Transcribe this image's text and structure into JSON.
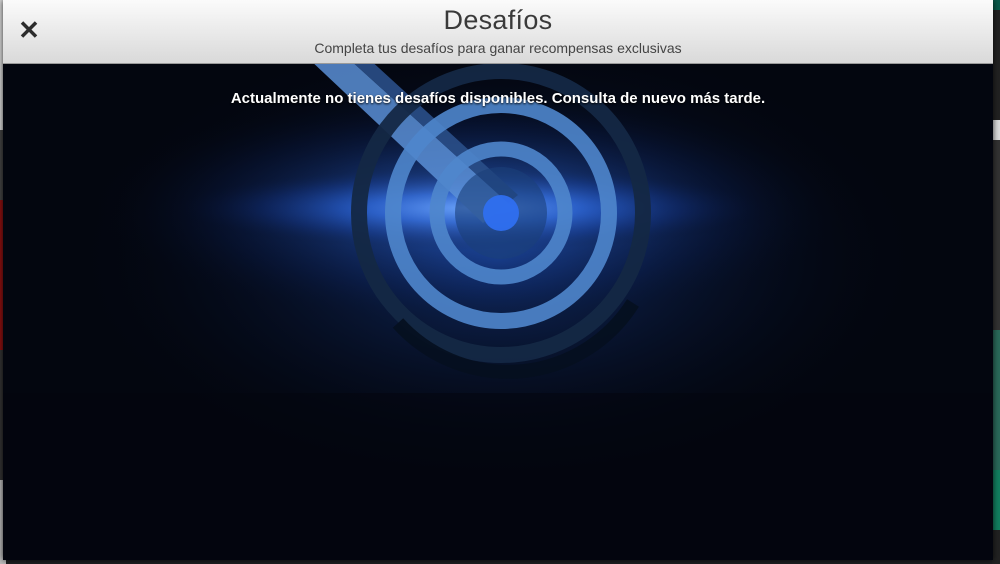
{
  "modal": {
    "title": "Desafíos",
    "subtitle": "Completa tus desafíos para ganar recompensas exclusivas",
    "message": "Actualmente no tienes desafíos disponibles. Consulta de nuevo más tarde.",
    "close_icon": "close-icon"
  },
  "colors": {
    "header_top": "#fbfbfb",
    "header_bottom": "#d9d9d9",
    "body_bg": "#03060f",
    "glow": "#2f6ff0"
  }
}
